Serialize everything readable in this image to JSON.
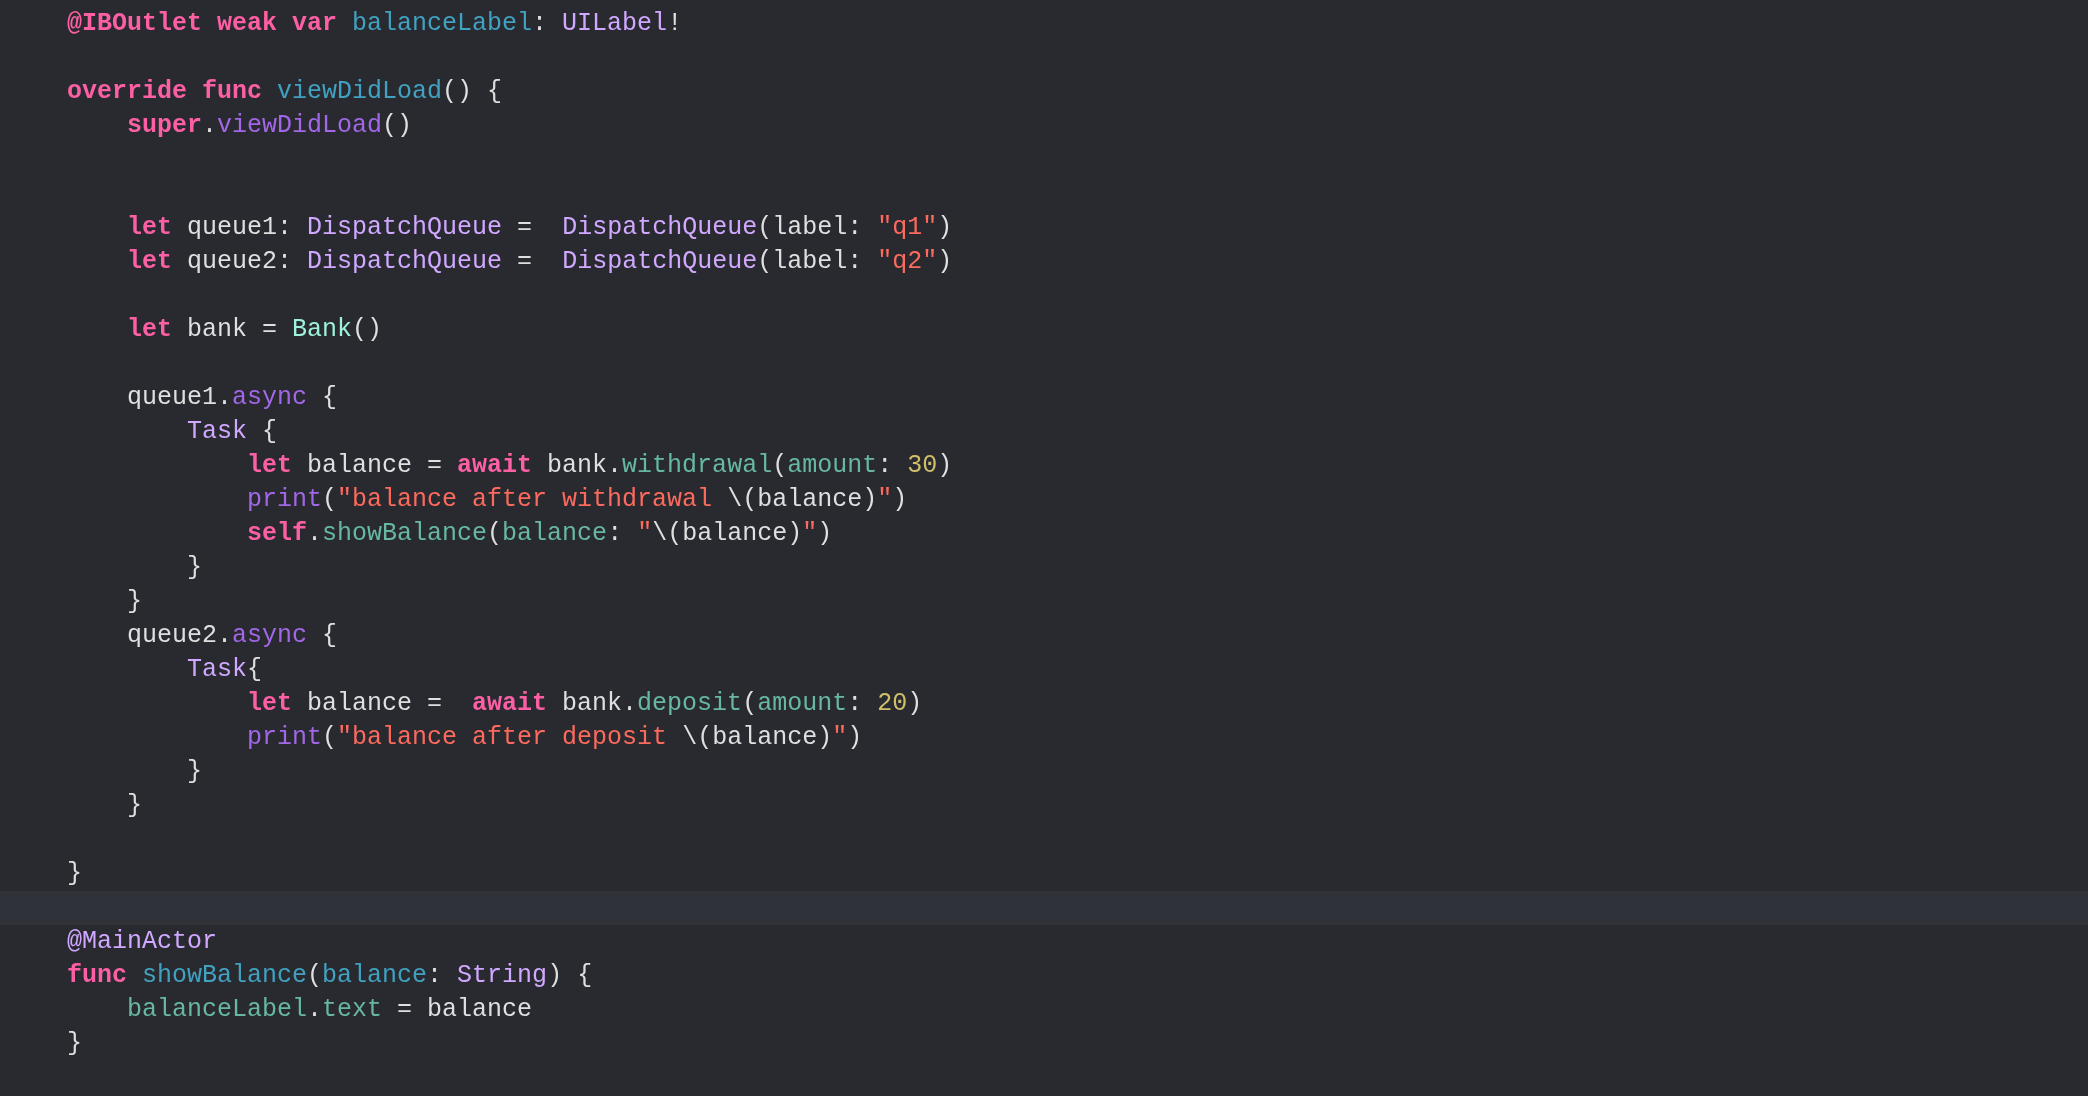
{
  "editor": {
    "lines": [
      {
        "kind": "code",
        "tokens": [
          {
            "text": "@IBOutlet weak var ",
            "kind": "keyword"
          },
          {
            "text": "balanceLabel",
            "kind": "decl"
          },
          {
            "text": ": ",
            "kind": "plain"
          },
          {
            "text": "UILabel",
            "kind": "type"
          },
          {
            "text": "!",
            "kind": "plain"
          }
        ]
      },
      {
        "kind": "blank"
      },
      {
        "kind": "code",
        "tokens": [
          {
            "text": "override func ",
            "kind": "keyword"
          },
          {
            "text": "viewDidLoad",
            "kind": "decl"
          },
          {
            "text": "() {",
            "kind": "plain"
          }
        ]
      },
      {
        "kind": "code",
        "tokens": [
          {
            "text": "    super",
            "kind": "keyword"
          },
          {
            "text": ".",
            "kind": "plain"
          },
          {
            "text": "viewDidLoad",
            "kind": "func"
          },
          {
            "text": "()",
            "kind": "plain"
          }
        ]
      },
      {
        "kind": "blank"
      },
      {
        "kind": "blank"
      },
      {
        "kind": "code",
        "tokens": [
          {
            "text": "    let ",
            "kind": "keyword"
          },
          {
            "text": "queue1: ",
            "kind": "plain"
          },
          {
            "text": "DispatchQueue",
            "kind": "type"
          },
          {
            "text": " =  ",
            "kind": "plain"
          },
          {
            "text": "DispatchQueue",
            "kind": "type"
          },
          {
            "text": "(label: ",
            "kind": "plain"
          },
          {
            "text": "\"q1\"",
            "kind": "string"
          },
          {
            "text": ")",
            "kind": "plain"
          }
        ]
      },
      {
        "kind": "code",
        "tokens": [
          {
            "text": "    let ",
            "kind": "keyword"
          },
          {
            "text": "queue2: ",
            "kind": "plain"
          },
          {
            "text": "DispatchQueue",
            "kind": "type"
          },
          {
            "text": " =  ",
            "kind": "plain"
          },
          {
            "text": "DispatchQueue",
            "kind": "type"
          },
          {
            "text": "(label: ",
            "kind": "plain"
          },
          {
            "text": "\"q2\"",
            "kind": "string"
          },
          {
            "text": ")",
            "kind": "plain"
          }
        ]
      },
      {
        "kind": "blank"
      },
      {
        "kind": "code",
        "tokens": [
          {
            "text": "    let ",
            "kind": "keyword"
          },
          {
            "text": "bank = ",
            "kind": "plain"
          },
          {
            "text": "Bank",
            "kind": "projtype"
          },
          {
            "text": "()",
            "kind": "plain"
          }
        ]
      },
      {
        "kind": "blank"
      },
      {
        "kind": "code",
        "tokens": [
          {
            "text": "    queue1.",
            "kind": "plain"
          },
          {
            "text": "async",
            "kind": "func"
          },
          {
            "text": " {",
            "kind": "plain"
          }
        ]
      },
      {
        "kind": "code",
        "tokens": [
          {
            "text": "        Task",
            "kind": "type"
          },
          {
            "text": " {",
            "kind": "plain"
          }
        ]
      },
      {
        "kind": "code",
        "tokens": [
          {
            "text": "            let ",
            "kind": "keyword"
          },
          {
            "text": "balance = ",
            "kind": "plain"
          },
          {
            "text": "await",
            "kind": "keyword"
          },
          {
            "text": " bank.",
            "kind": "plain"
          },
          {
            "text": "withdrawal",
            "kind": "projfunc"
          },
          {
            "text": "(",
            "kind": "plain"
          },
          {
            "text": "amount",
            "kind": "projfunc"
          },
          {
            "text": ": ",
            "kind": "plain"
          },
          {
            "text": "30",
            "kind": "number"
          },
          {
            "text": ")",
            "kind": "plain"
          }
        ]
      },
      {
        "kind": "code",
        "tokens": [
          {
            "text": "            print",
            "kind": "func"
          },
          {
            "text": "(",
            "kind": "plain"
          },
          {
            "text": "\"balance after withdrawal ",
            "kind": "string"
          },
          {
            "text": "\\(balance)",
            "kind": "plain"
          },
          {
            "text": "\"",
            "kind": "string"
          },
          {
            "text": ")",
            "kind": "plain"
          }
        ]
      },
      {
        "kind": "code",
        "tokens": [
          {
            "text": "            self",
            "kind": "keyword"
          },
          {
            "text": ".",
            "kind": "plain"
          },
          {
            "text": "showBalance",
            "kind": "projfunc"
          },
          {
            "text": "(",
            "kind": "plain"
          },
          {
            "text": "balance",
            "kind": "projfunc"
          },
          {
            "text": ": ",
            "kind": "plain"
          },
          {
            "text": "\"",
            "kind": "string"
          },
          {
            "text": "\\(balance)",
            "kind": "plain"
          },
          {
            "text": "\"",
            "kind": "string"
          },
          {
            "text": ")",
            "kind": "plain"
          }
        ]
      },
      {
        "kind": "code",
        "tokens": [
          {
            "text": "        }",
            "kind": "plain"
          }
        ]
      },
      {
        "kind": "code",
        "tokens": [
          {
            "text": "    }",
            "kind": "plain"
          }
        ]
      },
      {
        "kind": "code",
        "tokens": [
          {
            "text": "    queue2.",
            "kind": "plain"
          },
          {
            "text": "async",
            "kind": "func"
          },
          {
            "text": " {",
            "kind": "plain"
          }
        ]
      },
      {
        "kind": "code",
        "tokens": [
          {
            "text": "        Task",
            "kind": "type"
          },
          {
            "text": "{",
            "kind": "plain"
          }
        ]
      },
      {
        "kind": "code",
        "tokens": [
          {
            "text": "            let ",
            "kind": "keyword"
          },
          {
            "text": "balance =  ",
            "kind": "plain"
          },
          {
            "text": "await",
            "kind": "keyword"
          },
          {
            "text": " bank.",
            "kind": "plain"
          },
          {
            "text": "deposit",
            "kind": "projfunc"
          },
          {
            "text": "(",
            "kind": "plain"
          },
          {
            "text": "amount",
            "kind": "projfunc"
          },
          {
            "text": ": ",
            "kind": "plain"
          },
          {
            "text": "20",
            "kind": "number"
          },
          {
            "text": ")",
            "kind": "plain"
          }
        ]
      },
      {
        "kind": "code",
        "tokens": [
          {
            "text": "            print",
            "kind": "func"
          },
          {
            "text": "(",
            "kind": "plain"
          },
          {
            "text": "\"balance after deposit ",
            "kind": "string"
          },
          {
            "text": "\\(balance)",
            "kind": "plain"
          },
          {
            "text": "\"",
            "kind": "string"
          },
          {
            "text": ")",
            "kind": "plain"
          }
        ]
      },
      {
        "kind": "code",
        "tokens": [
          {
            "text": "        }",
            "kind": "plain"
          }
        ]
      },
      {
        "kind": "code",
        "tokens": [
          {
            "text": "    }",
            "kind": "plain"
          }
        ]
      },
      {
        "kind": "blank"
      },
      {
        "kind": "code",
        "tokens": [
          {
            "text": "}",
            "kind": "plain"
          }
        ]
      },
      {
        "kind": "current"
      },
      {
        "kind": "code",
        "tokens": [
          {
            "text": "@MainActor",
            "kind": "type"
          }
        ]
      },
      {
        "kind": "code",
        "tokens": [
          {
            "text": "func ",
            "kind": "keyword"
          },
          {
            "text": "showBalance",
            "kind": "decl"
          },
          {
            "text": "(",
            "kind": "plain"
          },
          {
            "text": "balance",
            "kind": "decl"
          },
          {
            "text": ": ",
            "kind": "plain"
          },
          {
            "text": "String",
            "kind": "type"
          },
          {
            "text": ") {",
            "kind": "plain"
          }
        ]
      },
      {
        "kind": "code",
        "tokens": [
          {
            "text": "    balanceLabel",
            "kind": "projfunc"
          },
          {
            "text": ".",
            "kind": "plain"
          },
          {
            "text": "text",
            "kind": "projfunc"
          },
          {
            "text": " = balance",
            "kind": "plain"
          }
        ]
      },
      {
        "kind": "code",
        "tokens": [
          {
            "text": "}",
            "kind": "plain"
          }
        ]
      }
    ]
  }
}
